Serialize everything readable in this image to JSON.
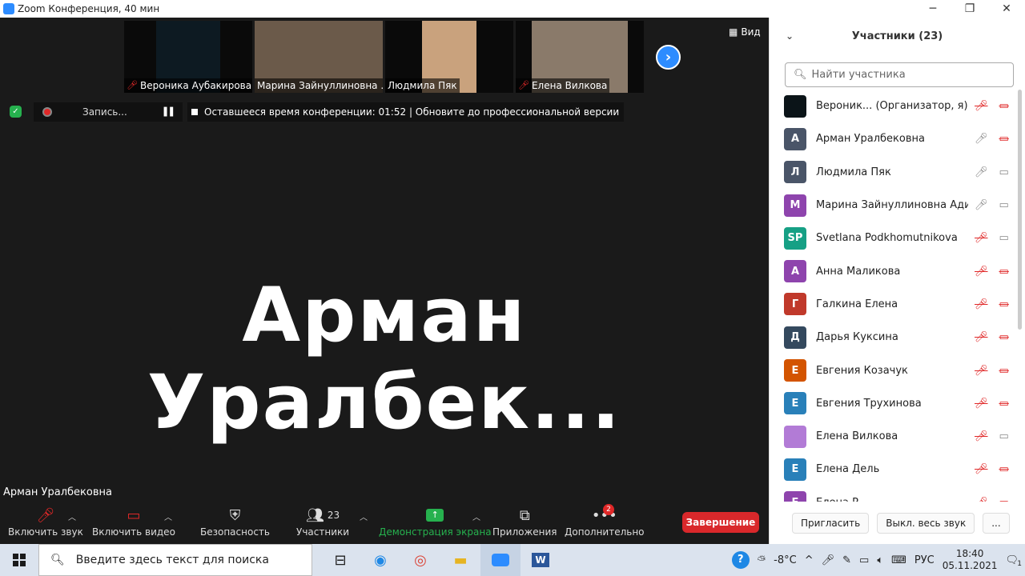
{
  "window": {
    "title": "Zoom Конференция, 40 мин"
  },
  "thumbnails": [
    {
      "name": "Вероника Аубакирова",
      "muted": true,
      "color": "#0d1a22"
    },
    {
      "name": "Марина Зайнуллиновна ...",
      "muted": false,
      "color": "#6b5a4a"
    },
    {
      "name": "Людмила Пяк",
      "muted": false,
      "color": "#c9a27d"
    },
    {
      "name": "Елена Вилкова",
      "muted": true,
      "color": "#8a7a6a"
    }
  ],
  "view_label": "Вид",
  "recording": {
    "label": "Запись..."
  },
  "time_notice": "Оставшееся время конференции: 01:52 | Обновите до профессиональной версии",
  "active_speaker_big": "Арман Уралбек...",
  "active_speaker_tag": "Арман Уралбековна",
  "toolbar": {
    "audio": "Включить звук",
    "video": "Включить видео",
    "security": "Безопасность",
    "participants": "Участники",
    "participants_count": "23",
    "share": "Демонстрация экрана",
    "apps": "Приложения",
    "more": "Дополнительно",
    "more_badge": "2",
    "end": "Завершение"
  },
  "panel": {
    "title": "Участники (23)",
    "search_placeholder": "Найти участника",
    "participants": [
      {
        "initials": "",
        "name": "Вероник...  (Организатор, я)",
        "color": "#0b1418",
        "mic": "off",
        "video": "off"
      },
      {
        "initials": "А",
        "name": "Арман Уралбековна",
        "color": "#4a5568",
        "mic": "on",
        "video": "off"
      },
      {
        "initials": "Л",
        "name": "Людмила Пяк",
        "color": "#4a5568",
        "mic": "on",
        "video": "on"
      },
      {
        "initials": "М",
        "name": "Марина Зайнуллиновна Адил...",
        "color": "#8e44ad",
        "mic": "on",
        "video": "on"
      },
      {
        "initials": "SP",
        "name": "Svetlana Podkhomutnikova",
        "color": "#16a085",
        "mic": "off",
        "video": "on"
      },
      {
        "initials": "А",
        "name": "Анна Маликова",
        "color": "#8e44ad",
        "mic": "off",
        "video": "off"
      },
      {
        "initials": "Г",
        "name": "Галкина Елена",
        "color": "#c0392b",
        "mic": "off",
        "video": "off"
      },
      {
        "initials": "Д",
        "name": "Дарья Куксина",
        "color": "#34495e",
        "mic": "off",
        "video": "off"
      },
      {
        "initials": "Е",
        "name": "Евгения Козачук",
        "color": "#d35400",
        "mic": "off",
        "video": "off"
      },
      {
        "initials": "Е",
        "name": "Евгения Трухинова",
        "color": "#2980b9",
        "mic": "off",
        "video": "off"
      },
      {
        "initials": "",
        "name": "Елена Вилкова",
        "color": "#b27bd6",
        "mic": "off",
        "video": "on"
      },
      {
        "initials": "Е",
        "name": "Елена Дель",
        "color": "#2980b9",
        "mic": "off",
        "video": "off"
      },
      {
        "initials": "Е",
        "name": "Елена Р...",
        "color": "#8e44ad",
        "mic": "off",
        "video": "off"
      }
    ],
    "invite": "Пригласить",
    "mute_all": "Выкл. весь звук",
    "more": "..."
  },
  "taskbar": {
    "search_placeholder": "Введите здесь текст для поиска",
    "weather": "-8°C",
    "lang": "РУС",
    "time": "18:40",
    "date": "05.11.2021",
    "notifications": "1"
  }
}
